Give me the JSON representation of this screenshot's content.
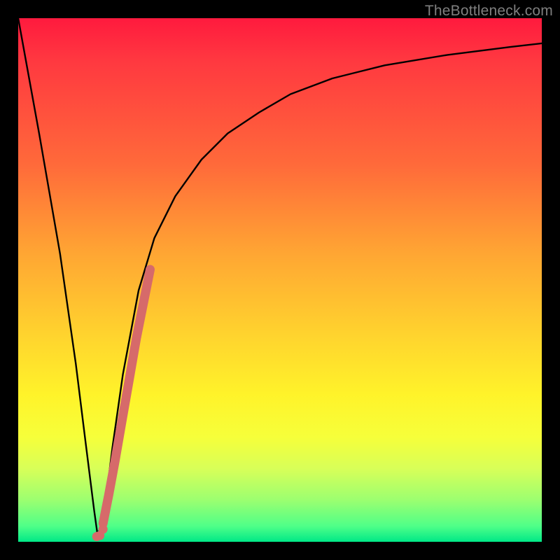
{
  "watermark": "TheBottleneck.com",
  "chart_data": {
    "type": "line",
    "title": "",
    "xlabel": "",
    "ylabel": "",
    "xlim": [
      0,
      100
    ],
    "ylim": [
      0,
      100
    ],
    "series": [
      {
        "name": "bottleneck-curve",
        "x": [
          0,
          4,
          8,
          11,
          13,
          14.5,
          15.2,
          16.5,
          18,
          20,
          23,
          26,
          30,
          35,
          40,
          46,
          52,
          60,
          70,
          82,
          94,
          100
        ],
        "y": [
          100,
          78,
          55,
          34,
          18,
          6,
          1,
          6,
          18,
          32,
          48,
          58,
          66,
          73,
          78,
          82,
          85.5,
          88.5,
          91,
          93,
          94.5,
          95.2
        ]
      }
    ],
    "highlight_segment": {
      "name": "highlighted-range",
      "color": "#d66a6a",
      "x": [
        16.2,
        17.3,
        18.5,
        19.8,
        21.2,
        22.6,
        24.0,
        25.2
      ],
      "y": [
        3.5,
        9.0,
        15.5,
        23.0,
        31.0,
        39.0,
        46.0,
        52.0
      ]
    },
    "highlight_minimum": {
      "name": "optimal-point-marker",
      "color": "#d66a6a",
      "points": [
        {
          "x": 15.0,
          "y": 1.0
        },
        {
          "x": 15.6,
          "y": 1.2
        },
        {
          "x": 16.2,
          "y": 2.4
        }
      ]
    }
  }
}
